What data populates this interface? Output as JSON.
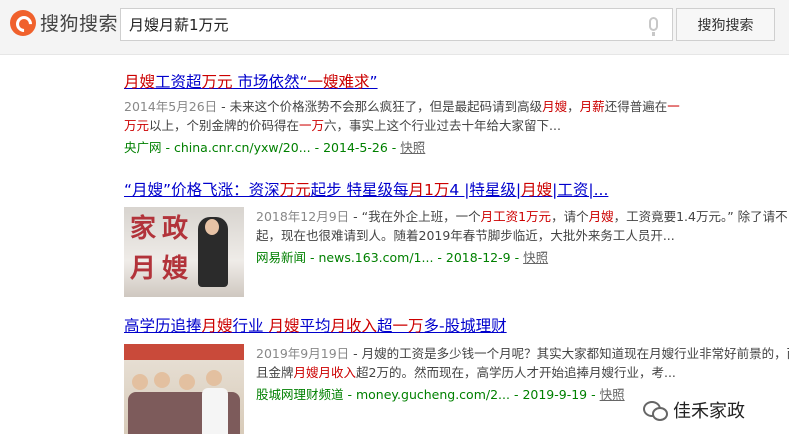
{
  "header": {
    "logo_text": "搜狗搜索",
    "query": "月嫂月薪1万元",
    "search_button": "搜狗搜索"
  },
  "results": [
    {
      "title_parts": [
        "月嫂",
        "工资超",
        "万元",
        " 市场依然“",
        "一嫂难求",
        "”"
      ],
      "date": "2014年5月26日",
      "snippet_parts": [
        " - 未来这个价格涨势不会那么疯狂了，但是最起码请到高级",
        "月嫂",
        "，",
        "月薪",
        "还得普遍在",
        "一万元",
        "以上，个别金牌的价码得在",
        "一万",
        "六，事实上这个行业过去十年给大家留下..."
      ],
      "source": "央广网",
      "url": "china.cnr.cn/yxw/20...",
      "pub_date": "2014-5-26",
      "snapshot": "快照"
    },
    {
      "title_parts": [
        "“月嫂”",
        "价格飞涨：资深",
        "万元",
        "起步 特星级每",
        "月1万",
        "4 |特星级|",
        "月嫂",
        "|工资|..."
      ],
      "thumb_chars": "家政月嫂",
      "date": "2018年12月9日",
      "snippet_parts": [
        " - “我在外企上班，一个",
        "月工资1万元",
        "，请个",
        "月嫂",
        "，工资竟要1.4万元。” 除了请不起，现在也很难请到人。随着2019年春节脚步临近，大批外来务工人员开..."
      ],
      "source": "网易新闻",
      "url": "news.163.com/1...",
      "pub_date": "2018-12-9",
      "snapshot": "快照"
    },
    {
      "title_parts": [
        "高学历追捧",
        "月嫂",
        "行业 ",
        "月嫂",
        "平均",
        "月收入",
        "超",
        "一万",
        "多-股城理财"
      ],
      "date": "2019年9月19日",
      "snippet_parts": [
        " - 月嫂的工资是多少钱一个月呢？其实大家都知道现在月嫂行业非常好前景的，而且金牌",
        "月嫂月收入",
        "超2万的。然而现在，高学历人才开始追捧月嫂行业，考..."
      ],
      "source": "股城网理财频道",
      "url": "money.gucheng.com/2...",
      "pub_date": "2019-9-19",
      "snapshot": "快照"
    }
  ],
  "watermark": "佳禾家政"
}
